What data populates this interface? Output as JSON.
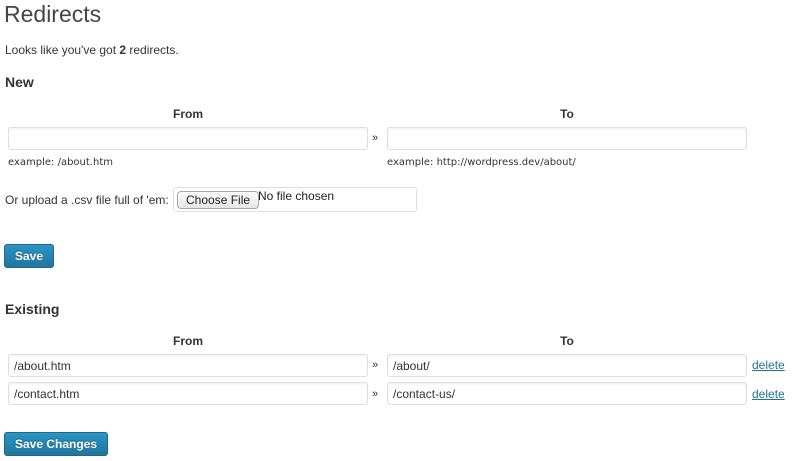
{
  "page": {
    "title": "Redirects"
  },
  "summary": {
    "prefix": "Looks like you've got ",
    "count": "2",
    "suffix": " redirects."
  },
  "new_section": {
    "heading": "New",
    "from_header": "From",
    "to_header": "To",
    "arrow": "»",
    "from_value": "",
    "to_value": "",
    "from_hint": "example: /about.htm",
    "to_hint": "example: http://wordpress.dev/about/",
    "upload_label": "Or upload a .csv file full of 'em:",
    "choose_file_label": "Choose File",
    "file_status": "No file chosen",
    "save_label": "Save"
  },
  "existing_section": {
    "heading": "Existing",
    "from_header": "From",
    "to_header": "To",
    "rows": [
      {
        "from": "/about.htm",
        "arrow": "»",
        "to": "/about/",
        "delete_label": "delete"
      },
      {
        "from": "/contact.htm",
        "arrow": "»",
        "to": "/contact-us/",
        "delete_label": "delete"
      }
    ],
    "save_changes_label": "Save Changes"
  },
  "colors": {
    "accent": "#21759b",
    "button_top": "#2a95c5",
    "input_border": "#dfdfdf"
  }
}
